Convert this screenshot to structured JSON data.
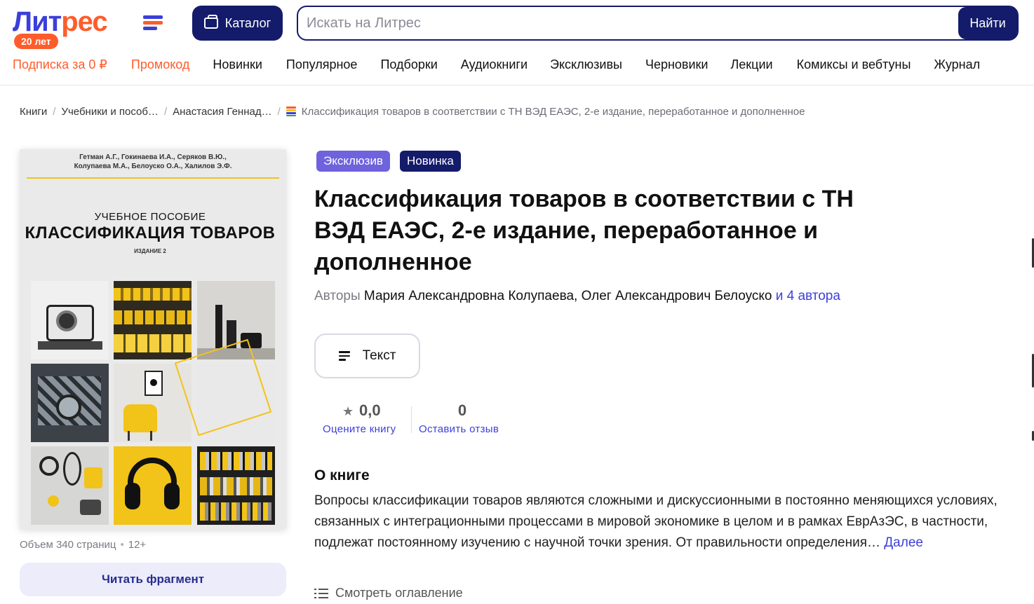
{
  "header": {
    "logo": {
      "part1": "Лит",
      "part2": "рес",
      "badge": "20 лет"
    },
    "catalog_label": "Каталог",
    "search": {
      "placeholder": "Искать на Литрес",
      "value": "",
      "button_label": "Найти"
    },
    "nav": [
      {
        "label": "Подписка за 0 ₽",
        "accent": true
      },
      {
        "label": "Промокод",
        "accent": true
      },
      {
        "label": "Новинки",
        "accent": false
      },
      {
        "label": "Популярное",
        "accent": false
      },
      {
        "label": "Подборки",
        "accent": false
      },
      {
        "label": "Аудиокниги",
        "accent": false
      },
      {
        "label": "Эксклюзивы",
        "accent": false
      },
      {
        "label": "Черновики",
        "accent": false
      },
      {
        "label": "Лекции",
        "accent": false
      },
      {
        "label": "Комиксы и вебтуны",
        "accent": false
      },
      {
        "label": "Журнал",
        "accent": false
      }
    ]
  },
  "breadcrumbs": [
    {
      "label": "Книги"
    },
    {
      "label": "Учебники и пособ…"
    },
    {
      "label": "Анастасия Геннад…"
    }
  ],
  "breadcrumb_current": "Классификация товаров в соответствии с ТН ВЭД ЕАЭС, 2-е издание, переработанное и дополненное",
  "cover": {
    "authors_line1": "Гетман А.Г., Гокинаева И.А., Серяков В.Ю.,",
    "authors_line2": "Колупаева М.А., Белоуско О.А., Халилов Э.Ф.",
    "subtitle": "УЧЕБНОЕ ПОСОБИЕ",
    "title": "КЛАССИФИКАЦИЯ ТОВАРОВ",
    "edition": "ИЗДАНИЕ 2"
  },
  "book_meta": {
    "pages": "Объем 340 страниц",
    "age": "12+"
  },
  "read_fragment_label": "Читать фрагмент",
  "badges": {
    "exclusive": "Эксклюзив",
    "new": "Новинка"
  },
  "book": {
    "title": "Классификация товаров в соответствии с ТН ВЭД ЕАЭС, 2-е издание, переработанное и дополненное",
    "authors_prefix": "Авторы",
    "author1": "Мария Александровна Колупаева",
    "author_sep": ", ",
    "author2": "Олег Александрович Белоуско",
    "authors_more": "и 4 автора"
  },
  "format_label": "Текст",
  "rating": {
    "value": "0,0",
    "rate_label": "Оцените книгу",
    "reviews_count": "0",
    "review_label": "Оставить отзыв"
  },
  "about": {
    "title": "О книге",
    "text": "Вопросы классификации товаров являются сложными и дискуссионными в постоянно меняющихся условиях, связанных с интеграционными процессами в мировой экономике в целом и в рамках ЕврАзЭС, в частности, подлежат постоянному изучению с научной точки зрения. От правильности определения… ",
    "more_label": "Далее",
    "toc_label": "Смотреть оглавление"
  },
  "colors": {
    "brand_blue": "#3b3fd8",
    "brand_orange": "#ff5c2b",
    "dark_navy": "#141b6b",
    "badge_purple": "#6f62dd",
    "link_blue": "#3b3fd8",
    "cover_yellow": "#f2c318"
  },
  "icons": [
    "hamburger-logo-icon",
    "bag-icon",
    "book-stack-icon",
    "text-lines-icon",
    "star-icon",
    "list-icon"
  ]
}
